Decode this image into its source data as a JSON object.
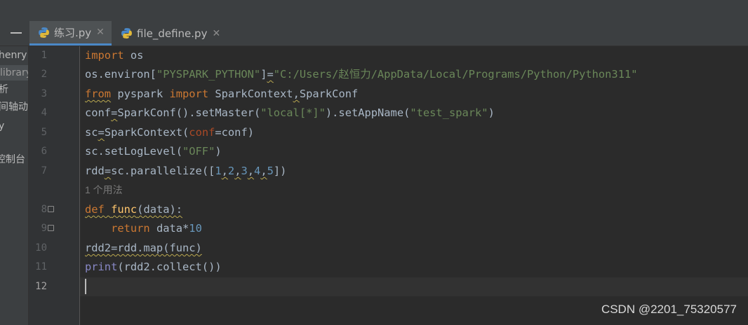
{
  "tabs": [
    {
      "label": "练习.py",
      "active": true
    },
    {
      "label": "file_define.py",
      "active": false
    }
  ],
  "project_panel": {
    "items": [
      "henry",
      "library",
      "析",
      "间轴动",
      "y",
      "",
      "控制台"
    ]
  },
  "gutter": {
    "line_numbers": [
      "1",
      "2",
      "3",
      "4",
      "5",
      "6",
      "7",
      "8",
      "9",
      "10",
      "11",
      "12"
    ],
    "current_line": "12"
  },
  "editor": {
    "usage_hint": "1 个用法",
    "lines": [
      [
        {
          "t": "import",
          "c": "kw"
        },
        {
          "t": " os"
        }
      ],
      [
        {
          "t": "os.environ["
        },
        {
          "t": "\"PYSPARK_PYTHON\"",
          "c": "str"
        },
        {
          "t": "]"
        },
        {
          "t": "=",
          "w": 1
        },
        {
          "t": "\"C:/Users/赵恒力/AppData/Local/Programs/Python/Python311\"",
          "c": "str"
        }
      ],
      [
        {
          "t": "from",
          "c": "kw",
          "w": 1
        },
        {
          "t": " pyspark "
        },
        {
          "t": "import",
          "c": "kw"
        },
        {
          "t": " SparkContext"
        },
        {
          "t": ",",
          "w": 1
        },
        {
          "t": "SparkConf"
        }
      ],
      [
        {
          "t": "conf"
        },
        {
          "t": "=",
          "w": 1
        },
        {
          "t": "SparkConf().setMaster("
        },
        {
          "t": "\"local[*]\"",
          "c": "str"
        },
        {
          "t": ").setAppName("
        },
        {
          "t": "\"test_spark\"",
          "c": "str"
        },
        {
          "t": ")"
        }
      ],
      [
        {
          "t": "sc"
        },
        {
          "t": "=",
          "w": 1
        },
        {
          "t": "SparkContext("
        },
        {
          "t": "conf",
          "c": "param"
        },
        {
          "t": "=conf)"
        }
      ],
      [
        {
          "t": "sc.setLogLevel("
        },
        {
          "t": "\"OFF\"",
          "c": "str"
        },
        {
          "t": ")"
        }
      ],
      [
        {
          "t": "rdd"
        },
        {
          "t": "=",
          "w": 1
        },
        {
          "t": "sc.parallelize(["
        },
        {
          "t": "1",
          "c": "num"
        },
        {
          "t": ",",
          "w": 1
        },
        {
          "t": "2",
          "c": "num"
        },
        {
          "t": ",",
          "w": 1
        },
        {
          "t": "3",
          "c": "num"
        },
        {
          "t": ",",
          "w": 1
        },
        {
          "t": "4",
          "c": "num"
        },
        {
          "t": ",",
          "w": 1
        },
        {
          "t": "5",
          "c": "num"
        },
        {
          "t": "])"
        }
      ],
      [
        {
          "t": "def",
          "c": "kw",
          "w": 1
        },
        {
          "t": " ",
          "w": 1
        },
        {
          "t": "func",
          "c": "fn",
          "w": 1
        },
        {
          "t": "(data):",
          "w": 1
        }
      ],
      [
        {
          "t": "    "
        },
        {
          "t": "return",
          "c": "kw"
        },
        {
          "t": " data*"
        },
        {
          "t": "10",
          "c": "num"
        }
      ],
      [
        {
          "t": "rdd2=rdd.map(func)",
          "w": 1
        }
      ],
      [
        {
          "t": "print",
          "c": "bi"
        },
        {
          "t": "(rdd2.collect())"
        }
      ],
      []
    ]
  },
  "watermark": "CSDN @2201_75320577",
  "colors": {
    "keyword": "#cc7832",
    "string": "#6a8759",
    "number": "#6897bb",
    "function": "#ffc66d",
    "builtin": "#8888c6",
    "param": "#aa4926",
    "default_text": "#a9b7c6"
  }
}
